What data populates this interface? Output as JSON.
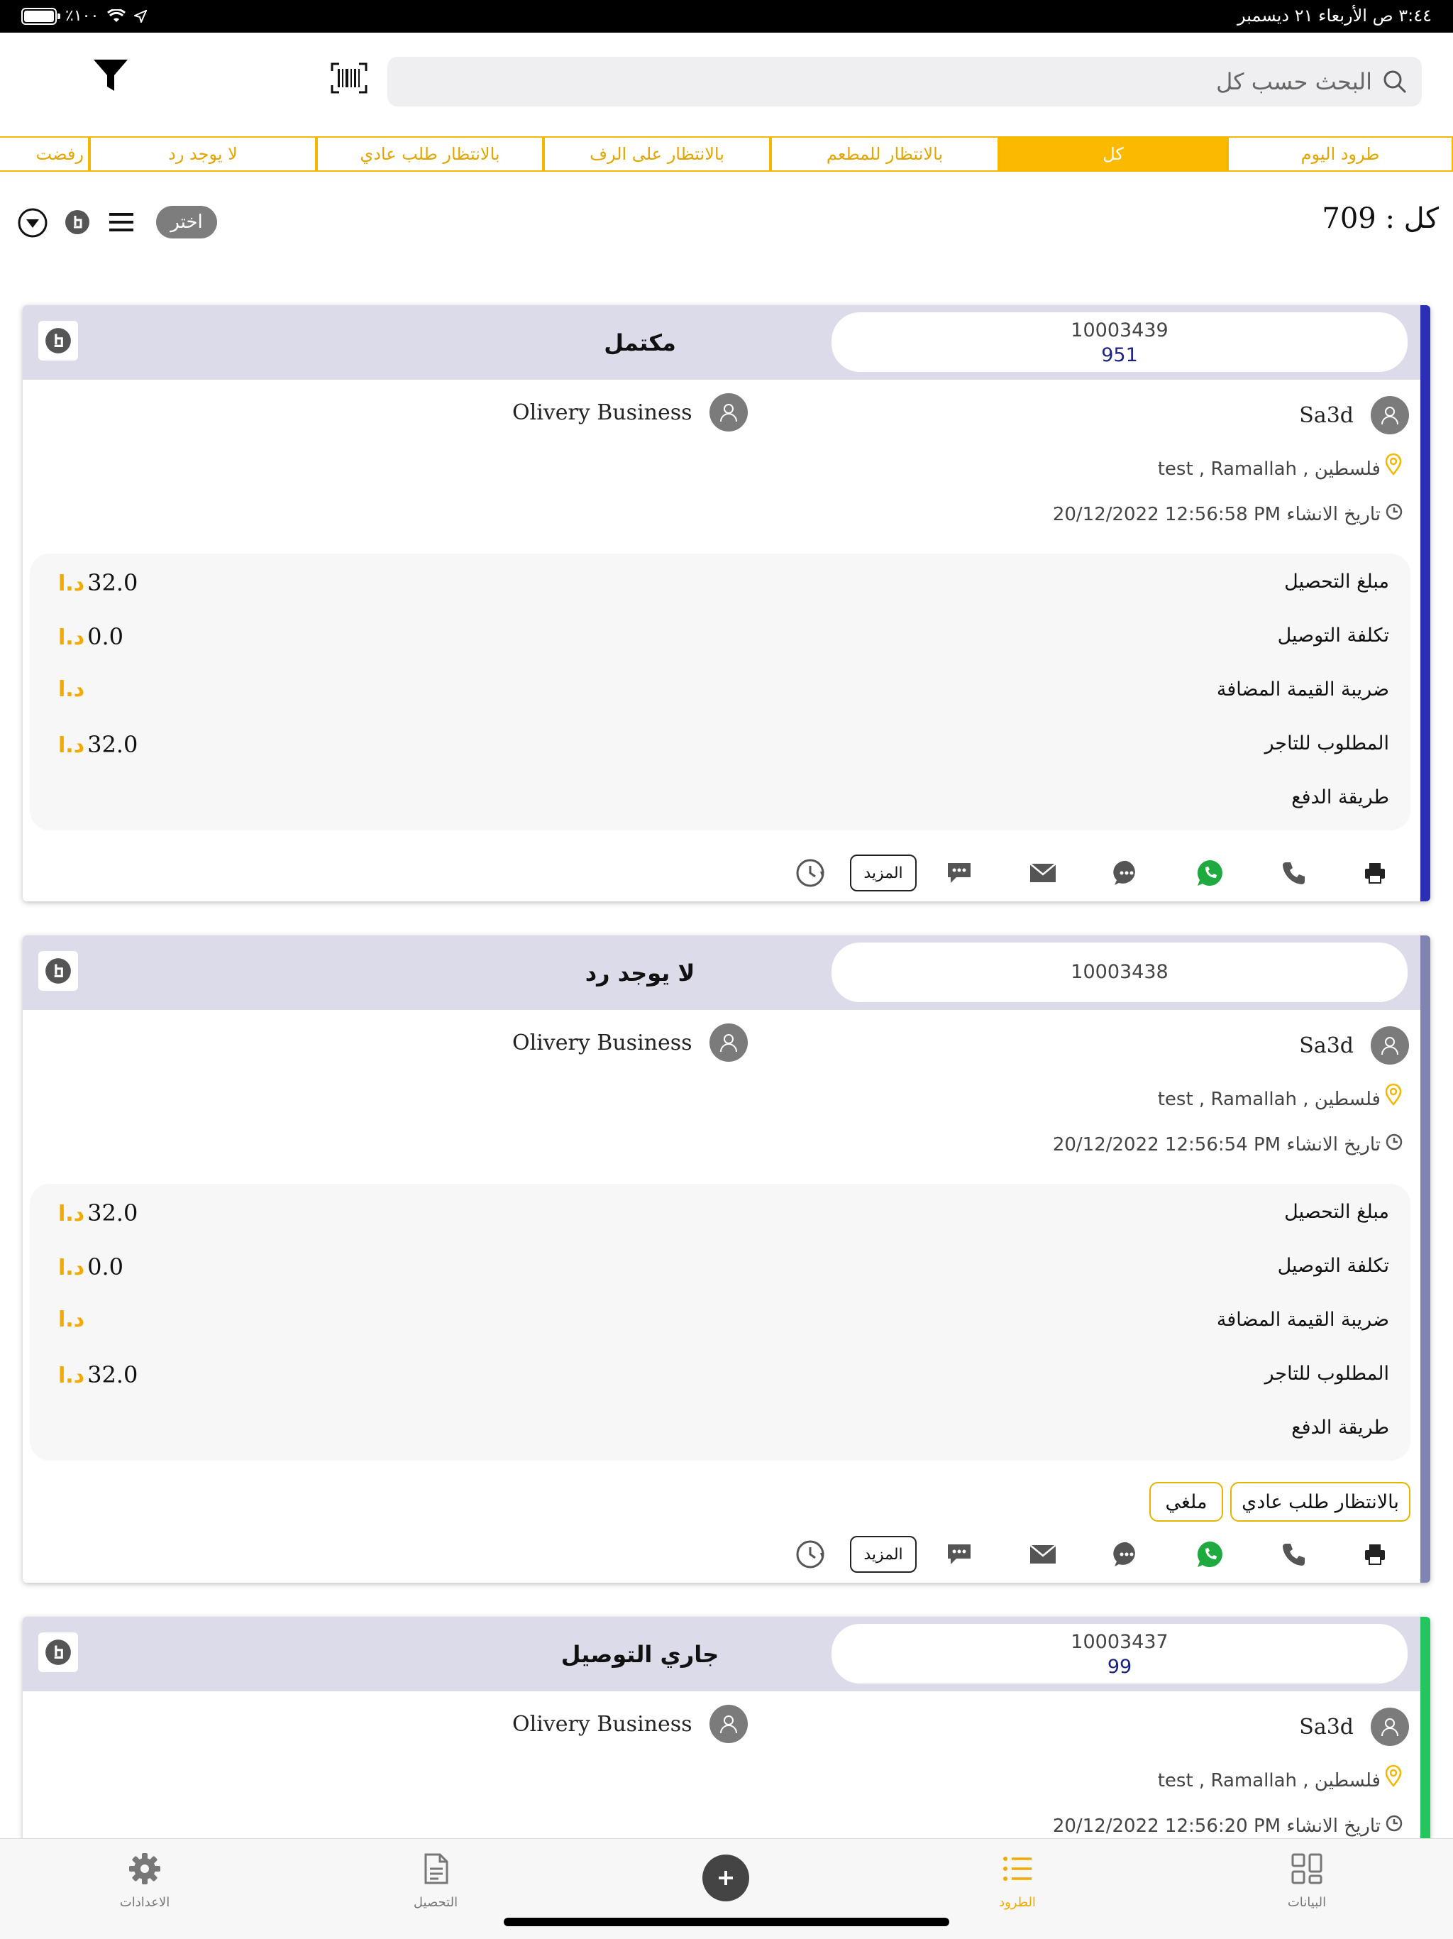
{
  "status_bar": {
    "time": "٣:٤٤ ص  الأربعاء ٢١ ديسمبر",
    "battery": "٪١٠٠"
  },
  "search": {
    "placeholder": "البحث حسب كل"
  },
  "tabs": [
    "طرود اليوم",
    "كل",
    "بالانتظار للمطعم",
    "بالانتظار على الرف",
    "بالانتظار طلب عادي",
    "لا يوجد رد",
    "رفضت"
  ],
  "active_tab": "كل",
  "summary": {
    "count_text": "كل : 709",
    "select_label": "اختر"
  },
  "card_labels": {
    "collect_amount": "مبلغ التحصيل",
    "delivery_cost": "تكلفة التوصيل",
    "vat": "ضريبة القيمة المضافة",
    "merchant_due": "المطلوب للتاجر",
    "payment_method": "طريقة الدفع",
    "currency": "د.ا",
    "more": "المزيد",
    "created_prefix": "تاريخ الانشاء"
  },
  "orders": [
    {
      "id": "10003439",
      "sub": "951",
      "status": "مكتمل",
      "status_color": "#2b2fb5",
      "business": "Olivery Business",
      "customer": "Sa3d",
      "address": "فلسطين , test , Ramallah",
      "created": "20/12/2022 12:56:58 PM",
      "collect": "32.0",
      "delivery": "0.0",
      "vat": "",
      "due": "32.0"
    },
    {
      "id": "10003438",
      "sub": "",
      "status": "لا يوجد رد",
      "status_color": "#7f85b0",
      "business": "Olivery Business",
      "customer": "Sa3d",
      "address": "فلسطين , test , Ramallah",
      "created": "20/12/2022 12:56:54 PM",
      "collect": "32.0",
      "delivery": "0.0",
      "vat": "",
      "due": "32.0",
      "chips": [
        "بالانتظار طلب عادي",
        "ملغي"
      ]
    },
    {
      "id": "10003437",
      "sub": "99",
      "status": "جاري التوصيل",
      "status_color": "#22c55e",
      "business": "Olivery Business",
      "customer": "Sa3d",
      "address": "فلسطين , test , Ramallah",
      "created": "20/12/2022 12:56:20 PM"
    }
  ],
  "bottom_nav": [
    {
      "label": "البيانات",
      "icon": "grid-icon"
    },
    {
      "label": "الطرود",
      "icon": "list-icon",
      "active": true
    },
    {
      "label": "",
      "icon": "plus-icon"
    },
    {
      "label": "التحصيل",
      "icon": "document-icon"
    },
    {
      "label": "الاعدادات",
      "icon": "gear-icon"
    }
  ],
  "colors": {
    "accent": "#fbb900",
    "card_header": "#dcdbea"
  }
}
